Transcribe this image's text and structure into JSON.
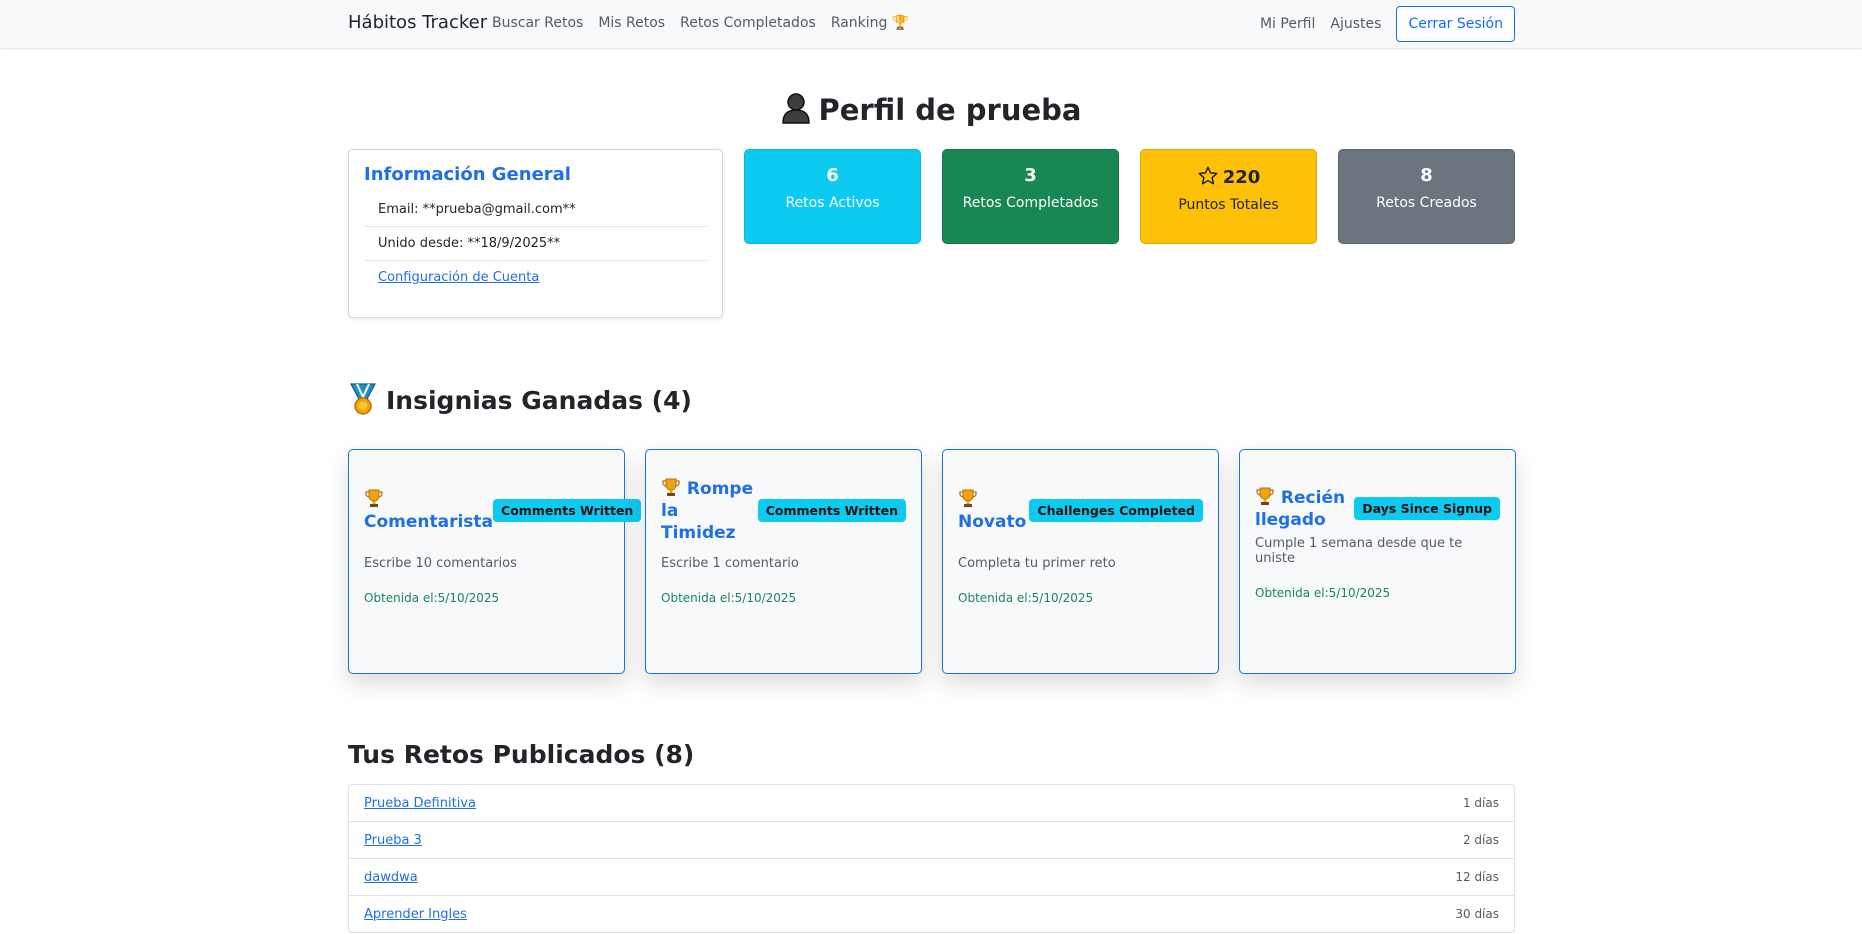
{
  "navbar": {
    "brand": "Hábitos Tracker",
    "links": [
      "Buscar Retos",
      "Mis Retos",
      "Retos Completados",
      "Ranking 🏆"
    ],
    "right_links": [
      "Mi Perfil",
      "Ajustes"
    ],
    "logout": "Cerrar Sesión"
  },
  "profile": {
    "title": "Perfil de prueba"
  },
  "info": {
    "title": "Información General",
    "email": "Email: **prueba@gmail.com**",
    "joined": "Unido desde: **18/9/2025**",
    "settings_link": "Configuración de Cuenta"
  },
  "stats": [
    {
      "value": "6",
      "label": "Retos Activos"
    },
    {
      "value": "3",
      "label": "Retos Completados"
    },
    {
      "value": "220",
      "label": "Puntos Totales"
    },
    {
      "value": "8",
      "label": "Retos Creados"
    }
  ],
  "badges_section": {
    "title": "Insignias Ganadas (4)"
  },
  "badges": [
    {
      "name": "Comentarista",
      "tag": "Comments Written",
      "description": "Escribe 10 comentarios",
      "date": "Obtenida el:5/10/2025"
    },
    {
      "name": "Rompe la Timidez",
      "tag": "Comments Written",
      "description": "Escribe 1 comentario",
      "date": "Obtenida el:5/10/2025"
    },
    {
      "name": "Novato",
      "tag": "Challenges Completed",
      "description": "Completa tu primer reto",
      "date": "Obtenida el:5/10/2025"
    },
    {
      "name": "Recién llegado",
      "tag": "Days Since Signup",
      "description": "Cumple 1 semana desde que te uniste",
      "date": "Obtenida el:5/10/2025"
    }
  ],
  "published": {
    "title": "Tus Retos Publicados (8)",
    "items": [
      {
        "name": "Prueba Definitiva",
        "days": "1 días"
      },
      {
        "name": "Prueba 3",
        "days": "2 días"
      },
      {
        "name": "dawdwa",
        "days": "12 días"
      },
      {
        "name": "Aprender Ingles",
        "days": "30 días"
      }
    ]
  },
  "icons": {
    "profile": "person-icon",
    "stars": "star-icon",
    "badges": "medal-icon",
    "badge": "trophy-icon"
  },
  "colors": {
    "primary": "#1f6fe5",
    "info": "#0dcaf0",
    "success": "#198754",
    "warning": "#ffc107",
    "secondary": "#6c757d"
  }
}
